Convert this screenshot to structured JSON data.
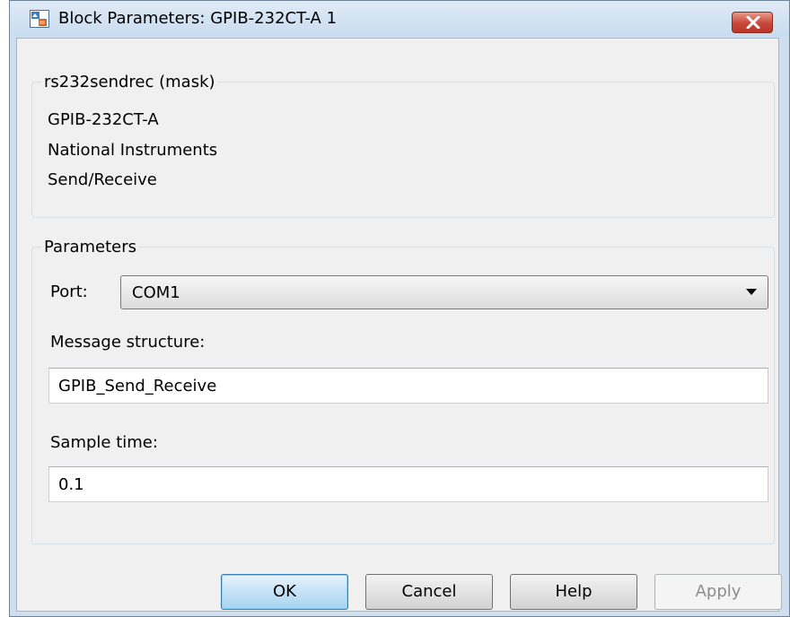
{
  "window": {
    "title": "Block Parameters: GPIB-232CT-A 1",
    "icon": "simulink-block-icon",
    "close_icon": "close-icon"
  },
  "mask": {
    "legend": "rs232sendrec (mask)",
    "description": [
      "GPIB-232CT-A",
      "National Instruments",
      "Send/Receive"
    ]
  },
  "parameters": {
    "legend": "Parameters",
    "port": {
      "label": "Port:",
      "value": "COM1",
      "icon": "chevron-down-icon"
    },
    "message_structure": {
      "label": "Message structure:",
      "value": "GPIB_Send_Receive"
    },
    "sample_time": {
      "label": "Sample time:",
      "value": "0.1"
    }
  },
  "buttons": {
    "ok": "OK",
    "cancel": "Cancel",
    "help": "Help",
    "apply": "Apply"
  },
  "colors": {
    "close_button": "#c9463a",
    "default_button": "#c4e2f6",
    "dialog_background": "#f0f0f0",
    "title_bar": "#cfdff0"
  }
}
